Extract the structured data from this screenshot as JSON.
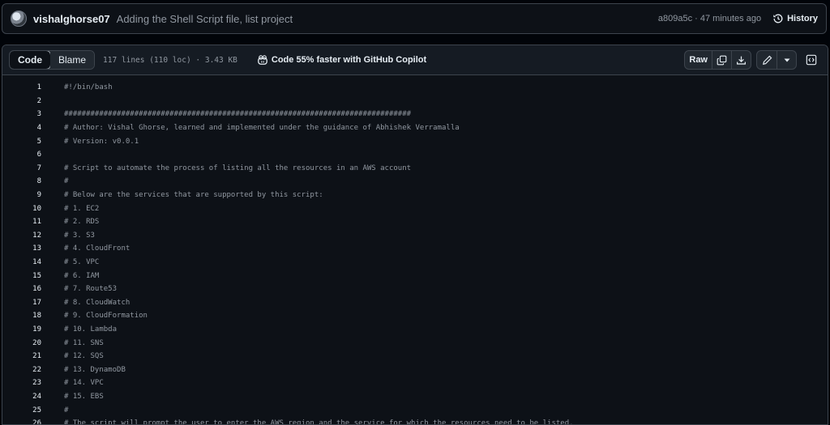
{
  "commit": {
    "author": "vishalghorse07",
    "message": "Adding the Shell Script file, list project",
    "hash_time": "a809a5c · 47 minutes ago",
    "history_label": "History"
  },
  "file_header": {
    "tabs": [
      {
        "label": "Code",
        "active": true
      },
      {
        "label": "Blame",
        "active": false
      }
    ],
    "meta": "117 lines (110 loc) · 3.43 KB",
    "copilot_text": "Code 55% faster with GitHub Copilot",
    "raw_label": "Raw"
  },
  "icons": {
    "history": "history-icon",
    "copilot": "copilot-icon",
    "copy": "copy-icon",
    "download": "download-icon",
    "edit": "pencil-icon",
    "dropdown": "triangle-down-icon",
    "symbols": "code-square-icon"
  },
  "colors": {
    "background": "#010409",
    "panel": "#0d1117",
    "header": "#151b23",
    "border": "#3d444d",
    "text": "#e6edf3",
    "muted": "#9198a1"
  },
  "code_lines": [
    {
      "n": "1",
      "text": "#!/bin/bash"
    },
    {
      "n": "2",
      "text": ""
    },
    {
      "n": "3",
      "text": "###############################################################################"
    },
    {
      "n": "4",
      "text": "# Author: Vishal Ghorse, learned and implemented under the guidance of Abhishek Verramalla"
    },
    {
      "n": "5",
      "text": "# Version: v0.0.1"
    },
    {
      "n": "6",
      "text": ""
    },
    {
      "n": "7",
      "text": "# Script to automate the process of listing all the resources in an AWS account"
    },
    {
      "n": "8",
      "text": "#"
    },
    {
      "n": "9",
      "text": "# Below are the services that are supported by this script:"
    },
    {
      "n": "10",
      "text": "# 1. EC2"
    },
    {
      "n": "11",
      "text": "# 2. RDS"
    },
    {
      "n": "12",
      "text": "# 3. S3"
    },
    {
      "n": "13",
      "text": "# 4. CloudFront"
    },
    {
      "n": "14",
      "text": "# 5. VPC"
    },
    {
      "n": "15",
      "text": "# 6. IAM"
    },
    {
      "n": "16",
      "text": "# 7. Route53"
    },
    {
      "n": "17",
      "text": "# 8. CloudWatch"
    },
    {
      "n": "18",
      "text": "# 9. CloudFormation"
    },
    {
      "n": "19",
      "text": "# 10. Lambda"
    },
    {
      "n": "20",
      "text": "# 11. SNS"
    },
    {
      "n": "21",
      "text": "# 12. SQS"
    },
    {
      "n": "22",
      "text": "# 13. DynamoDB"
    },
    {
      "n": "23",
      "text": "# 14. VPC"
    },
    {
      "n": "24",
      "text": "# 15. EBS"
    },
    {
      "n": "25",
      "text": "#"
    },
    {
      "n": "26",
      "text": "# The script will prompt the user to enter the AWS region and the service for which the resources need to be listed."
    }
  ]
}
